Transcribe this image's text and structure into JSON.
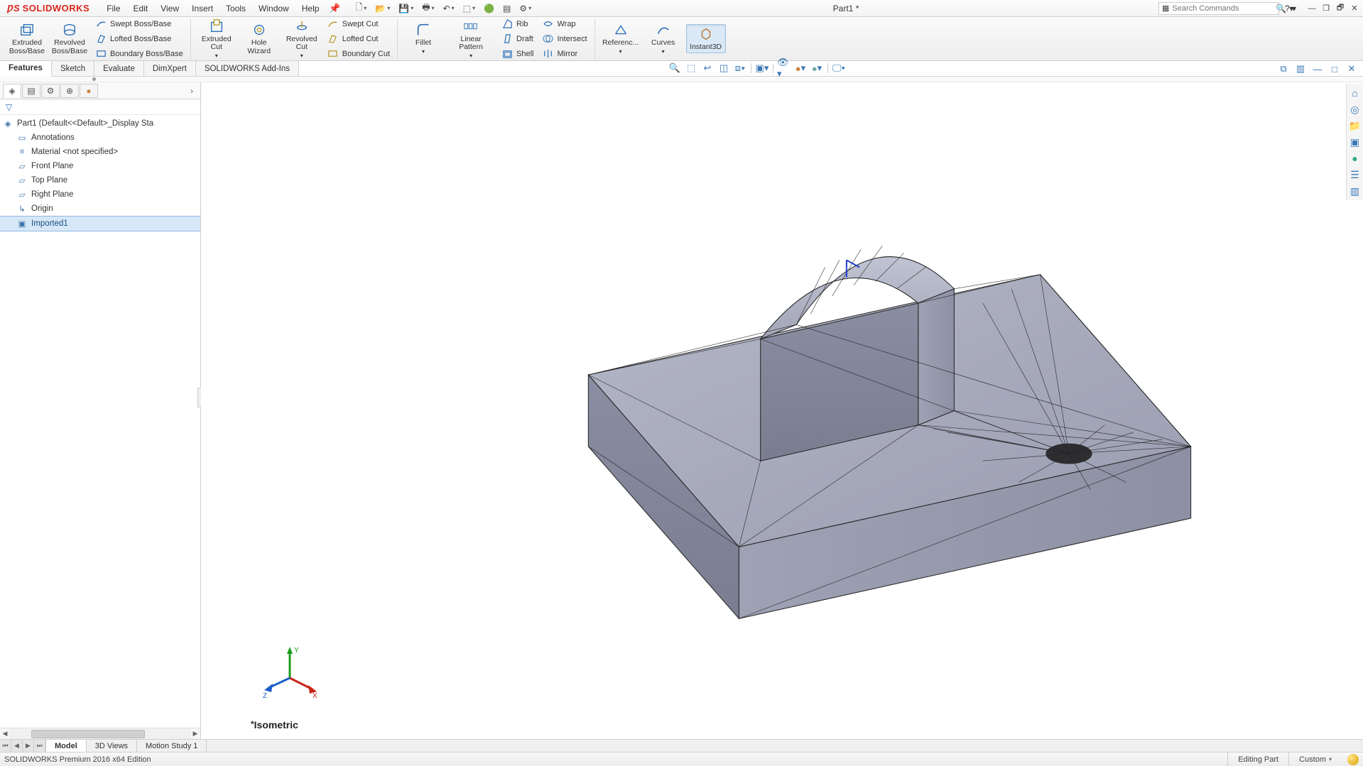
{
  "app": {
    "brand_prefix": "DS",
    "brand": "SOLIDWORKS",
    "menus": [
      "File",
      "Edit",
      "View",
      "Insert",
      "Tools",
      "Window",
      "Help"
    ],
    "document_title": "Part1 *",
    "search_placeholder": "Search Commands"
  },
  "ribbon": {
    "groups": {
      "boss": {
        "extruded": "Extruded Boss/Base",
        "revolved": "Revolved Boss/Base",
        "swept": "Swept Boss/Base",
        "lofted": "Lofted Boss/Base",
        "boundary": "Boundary Boss/Base"
      },
      "cut": {
        "extruded": "Extruded Cut",
        "wizard": "Hole Wizard",
        "revolved": "Revolved Cut",
        "swept": "Swept Cut",
        "lofted": "Lofted Cut",
        "boundary": "Boundary Cut"
      },
      "pattern": {
        "fillet": "Fillet",
        "linear": "Linear Pattern",
        "rib": "Rib",
        "draft": "Draft",
        "shell": "Shell",
        "wrap": "Wrap",
        "intersect": "Intersect",
        "mirror": "Mirror"
      },
      "ref": {
        "geometry": "Referenc...",
        "curves": "Curves",
        "instant3d": "Instant3D"
      }
    },
    "tabs": [
      "Features",
      "Sketch",
      "Evaluate",
      "DimXpert",
      "SOLIDWORKS Add-Ins"
    ],
    "active_tab": "Features"
  },
  "tree": {
    "root": "Part1  (Default<<Default>_Display Sta",
    "items": [
      {
        "label": "Annotations",
        "icon": "annotations"
      },
      {
        "label": "Material <not specified>",
        "icon": "material"
      },
      {
        "label": "Front Plane",
        "icon": "plane"
      },
      {
        "label": "Top Plane",
        "icon": "plane"
      },
      {
        "label": "Right Plane",
        "icon": "plane"
      },
      {
        "label": "Origin",
        "icon": "origin"
      },
      {
        "label": "Imported1",
        "icon": "imported",
        "selected": true
      }
    ]
  },
  "viewport": {
    "view_name": "Isometric",
    "triad_axes": {
      "x": "X",
      "y": "Y",
      "z": "Z"
    }
  },
  "bottom_tabs": [
    "Model",
    "3D Views",
    "Motion Study 1"
  ],
  "bottom_active": "Model",
  "status": {
    "edition": "SOLIDWORKS Premium 2016 x64 Edition",
    "mode": "Editing Part",
    "units": "Custom"
  }
}
